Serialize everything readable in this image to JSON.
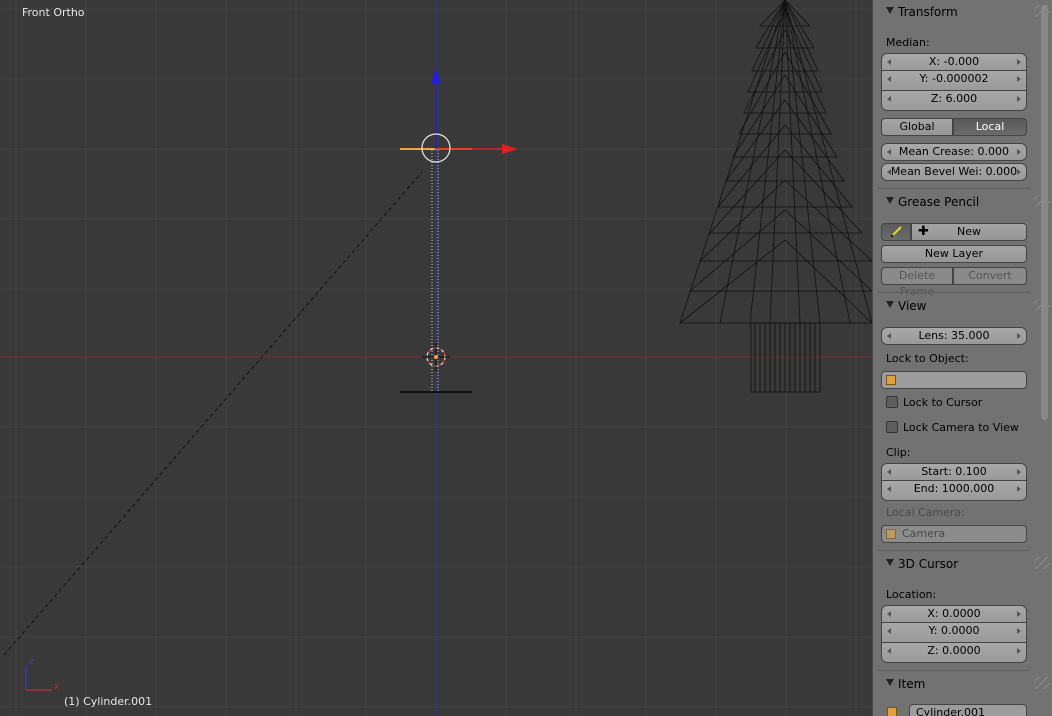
{
  "viewport": {
    "view_name": "Front Ortho",
    "object_label": "(1) Cylinder.001",
    "axis_z": "z",
    "axis_x": "x",
    "colors": {
      "background": "#393939",
      "x_axis": "#8b2a2a",
      "z_axis": "#2a2ab0",
      "selected": "#f0a030"
    }
  },
  "transform": {
    "title": "Transform",
    "median_label": "Median:",
    "x": "X: -0.000",
    "y": "Y: -0.000002",
    "z": "Z: 6.000",
    "global_label": "Global",
    "local_label": "Local",
    "mean_crease": "Mean Crease: 0.000",
    "mean_bevel": "Mean Bevel Wei: 0.000"
  },
  "grease_pencil": {
    "title": "Grease Pencil",
    "new_label": "New",
    "new_layer_label": "New Layer",
    "delete_frame_label": "Delete Frame",
    "convert_label": "Convert"
  },
  "view": {
    "title": "View",
    "lens": "Lens: 35.000",
    "lock_to_object_label": "Lock to Object:",
    "lock_to_cursor_label": "Lock to Cursor",
    "lock_camera_label": "Lock Camera to View",
    "clip_label": "Clip:",
    "clip_start": "Start: 0.100",
    "clip_end": "End: 1000.000",
    "local_camera_label": "Local Camera:",
    "camera_value": "Camera"
  },
  "cursor": {
    "title": "3D Cursor",
    "location_label": "Location:",
    "x": "X: 0.0000",
    "y": "Y: 0.0000",
    "z": "Z: 0.0000"
  },
  "item": {
    "title": "Item",
    "name": "Cylinder.001"
  }
}
